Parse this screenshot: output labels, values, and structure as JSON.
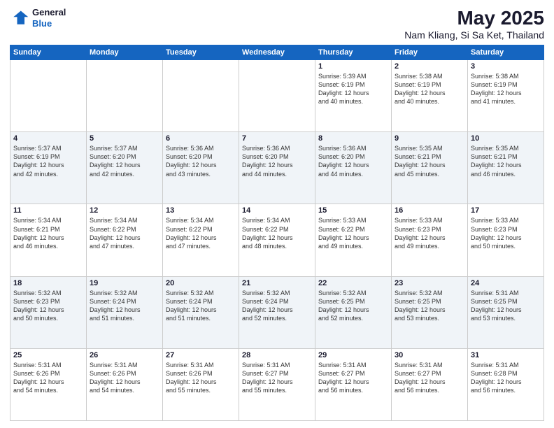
{
  "header": {
    "logo": {
      "line1": "General",
      "line2": "Blue"
    },
    "title": "May 2025",
    "subtitle": "Nam Kliang, Si Sa Ket, Thailand"
  },
  "calendar": {
    "days_of_week": [
      "Sunday",
      "Monday",
      "Tuesday",
      "Wednesday",
      "Thursday",
      "Friday",
      "Saturday"
    ],
    "weeks": [
      [
        {
          "day": "",
          "info": ""
        },
        {
          "day": "",
          "info": ""
        },
        {
          "day": "",
          "info": ""
        },
        {
          "day": "",
          "info": ""
        },
        {
          "day": "1",
          "info": "Sunrise: 5:39 AM\nSunset: 6:19 PM\nDaylight: 12 hours\nand 40 minutes."
        },
        {
          "day": "2",
          "info": "Sunrise: 5:38 AM\nSunset: 6:19 PM\nDaylight: 12 hours\nand 40 minutes."
        },
        {
          "day": "3",
          "info": "Sunrise: 5:38 AM\nSunset: 6:19 PM\nDaylight: 12 hours\nand 41 minutes."
        }
      ],
      [
        {
          "day": "4",
          "info": "Sunrise: 5:37 AM\nSunset: 6:19 PM\nDaylight: 12 hours\nand 42 minutes."
        },
        {
          "day": "5",
          "info": "Sunrise: 5:37 AM\nSunset: 6:20 PM\nDaylight: 12 hours\nand 42 minutes."
        },
        {
          "day": "6",
          "info": "Sunrise: 5:36 AM\nSunset: 6:20 PM\nDaylight: 12 hours\nand 43 minutes."
        },
        {
          "day": "7",
          "info": "Sunrise: 5:36 AM\nSunset: 6:20 PM\nDaylight: 12 hours\nand 44 minutes."
        },
        {
          "day": "8",
          "info": "Sunrise: 5:36 AM\nSunset: 6:20 PM\nDaylight: 12 hours\nand 44 minutes."
        },
        {
          "day": "9",
          "info": "Sunrise: 5:35 AM\nSunset: 6:21 PM\nDaylight: 12 hours\nand 45 minutes."
        },
        {
          "day": "10",
          "info": "Sunrise: 5:35 AM\nSunset: 6:21 PM\nDaylight: 12 hours\nand 46 minutes."
        }
      ],
      [
        {
          "day": "11",
          "info": "Sunrise: 5:34 AM\nSunset: 6:21 PM\nDaylight: 12 hours\nand 46 minutes."
        },
        {
          "day": "12",
          "info": "Sunrise: 5:34 AM\nSunset: 6:22 PM\nDaylight: 12 hours\nand 47 minutes."
        },
        {
          "day": "13",
          "info": "Sunrise: 5:34 AM\nSunset: 6:22 PM\nDaylight: 12 hours\nand 47 minutes."
        },
        {
          "day": "14",
          "info": "Sunrise: 5:34 AM\nSunset: 6:22 PM\nDaylight: 12 hours\nand 48 minutes."
        },
        {
          "day": "15",
          "info": "Sunrise: 5:33 AM\nSunset: 6:22 PM\nDaylight: 12 hours\nand 49 minutes."
        },
        {
          "day": "16",
          "info": "Sunrise: 5:33 AM\nSunset: 6:23 PM\nDaylight: 12 hours\nand 49 minutes."
        },
        {
          "day": "17",
          "info": "Sunrise: 5:33 AM\nSunset: 6:23 PM\nDaylight: 12 hours\nand 50 minutes."
        }
      ],
      [
        {
          "day": "18",
          "info": "Sunrise: 5:32 AM\nSunset: 6:23 PM\nDaylight: 12 hours\nand 50 minutes."
        },
        {
          "day": "19",
          "info": "Sunrise: 5:32 AM\nSunset: 6:24 PM\nDaylight: 12 hours\nand 51 minutes."
        },
        {
          "day": "20",
          "info": "Sunrise: 5:32 AM\nSunset: 6:24 PM\nDaylight: 12 hours\nand 51 minutes."
        },
        {
          "day": "21",
          "info": "Sunrise: 5:32 AM\nSunset: 6:24 PM\nDaylight: 12 hours\nand 52 minutes."
        },
        {
          "day": "22",
          "info": "Sunrise: 5:32 AM\nSunset: 6:25 PM\nDaylight: 12 hours\nand 52 minutes."
        },
        {
          "day": "23",
          "info": "Sunrise: 5:32 AM\nSunset: 6:25 PM\nDaylight: 12 hours\nand 53 minutes."
        },
        {
          "day": "24",
          "info": "Sunrise: 5:31 AM\nSunset: 6:25 PM\nDaylight: 12 hours\nand 53 minutes."
        }
      ],
      [
        {
          "day": "25",
          "info": "Sunrise: 5:31 AM\nSunset: 6:26 PM\nDaylight: 12 hours\nand 54 minutes."
        },
        {
          "day": "26",
          "info": "Sunrise: 5:31 AM\nSunset: 6:26 PM\nDaylight: 12 hours\nand 54 minutes."
        },
        {
          "day": "27",
          "info": "Sunrise: 5:31 AM\nSunset: 6:26 PM\nDaylight: 12 hours\nand 55 minutes."
        },
        {
          "day": "28",
          "info": "Sunrise: 5:31 AM\nSunset: 6:27 PM\nDaylight: 12 hours\nand 55 minutes."
        },
        {
          "day": "29",
          "info": "Sunrise: 5:31 AM\nSunset: 6:27 PM\nDaylight: 12 hours\nand 56 minutes."
        },
        {
          "day": "30",
          "info": "Sunrise: 5:31 AM\nSunset: 6:27 PM\nDaylight: 12 hours\nand 56 minutes."
        },
        {
          "day": "31",
          "info": "Sunrise: 5:31 AM\nSunset: 6:28 PM\nDaylight: 12 hours\nand 56 minutes."
        }
      ]
    ]
  }
}
